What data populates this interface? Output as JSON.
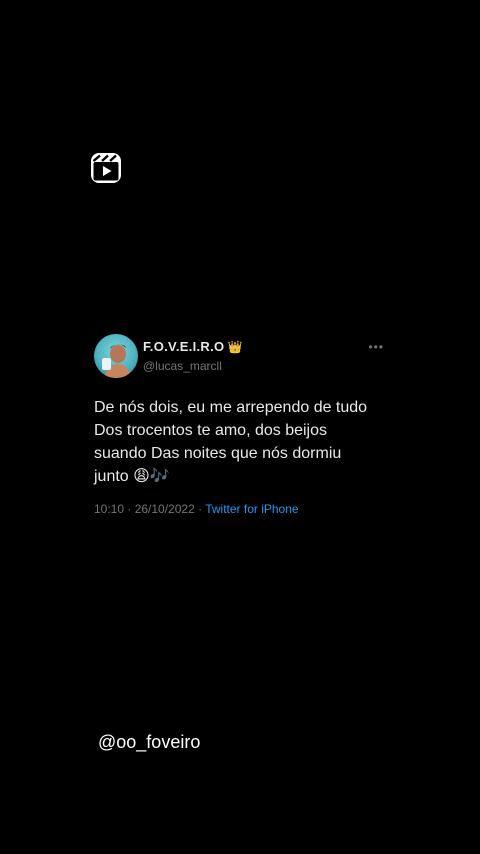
{
  "tweet": {
    "display_name": "F.O.V.E.I.R.O",
    "crown_emoji": "👑",
    "handle": "@lucas_marcll",
    "text": "De nós dois, eu me arrependo de tudo\nDos trocentos te amo, dos beijos\nsuando Das noites que nós dormiu\njunto 😩🎶",
    "time": "10:10 · 26/10/2022 · ",
    "source": "Twitter for iPhone",
    "more_icon": "more-options-icon"
  },
  "reels_icon": "reels-icon",
  "watermark": "@oo_foveiro"
}
